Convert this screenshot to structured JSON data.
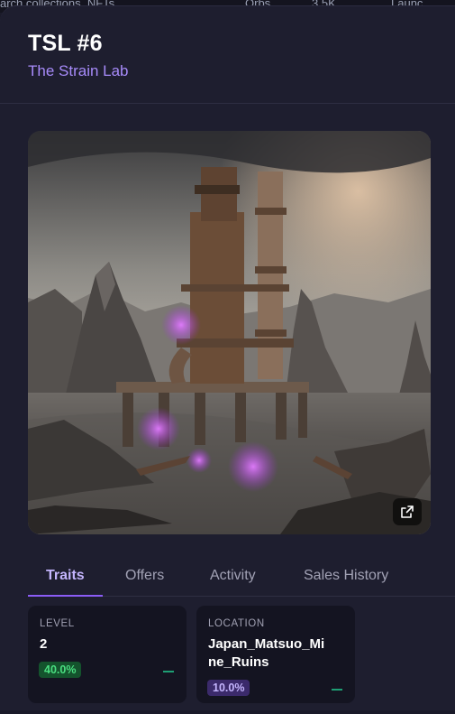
{
  "background": {
    "left_text": "arch collections, NFTs, ...",
    "mid_text": "Orbs",
    "mid_value": "3.5K",
    "right_text": "Launc"
  },
  "nft": {
    "title": "TSL #6",
    "collection": "The Strain Lab"
  },
  "tabs": [
    {
      "label": "Traits",
      "active": true
    },
    {
      "label": "Offers",
      "active": false
    },
    {
      "label": "Activity",
      "active": false
    },
    {
      "label": "Sales History",
      "active": false
    }
  ],
  "traits": [
    {
      "type": "LEVEL",
      "value": "2",
      "rarity": "40.0%"
    },
    {
      "type": "LOCATION",
      "value_line1": "Japan_Matsuo_Mi",
      "value_line2": "ne_Ruins",
      "rarity": "10.0%"
    }
  ],
  "icons": {
    "external": "external-link-icon"
  },
  "colors": {
    "accent": "#a78bfa",
    "panel": "#1e1e2f",
    "card": "#141421",
    "green": "#4ade80",
    "purple": "#c4b5fd"
  }
}
